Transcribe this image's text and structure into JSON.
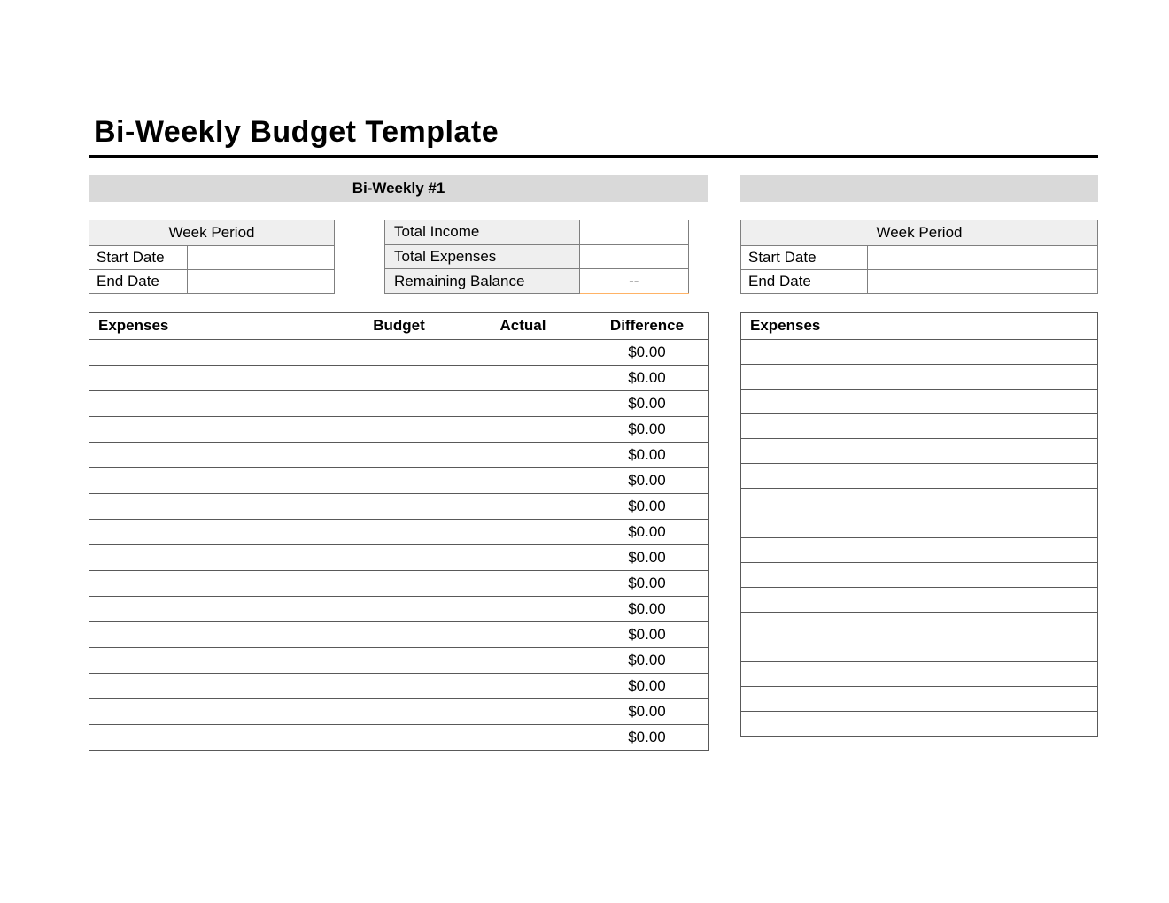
{
  "title": "Bi-Weekly Budget Template",
  "section1_header": "Bi-Weekly #1",
  "week_period": {
    "heading": "Week Period",
    "start_label": "Start Date",
    "end_label": "End Date",
    "start_value": "",
    "end_value": ""
  },
  "summary": {
    "total_income_label": "Total Income",
    "total_expenses_label": "Total Expenses",
    "remaining_balance_label": "Remaining Balance",
    "total_income_value": "",
    "total_expenses_value": "",
    "remaining_balance_value": "--"
  },
  "columns": {
    "expenses": "Expenses",
    "budget": "Budget",
    "actual": "Actual",
    "difference": "Difference"
  },
  "expense_rows": [
    {
      "name": "",
      "budget": "",
      "actual": "",
      "difference": "$0.00"
    },
    {
      "name": "",
      "budget": "",
      "actual": "",
      "difference": "$0.00"
    },
    {
      "name": "",
      "budget": "",
      "actual": "",
      "difference": "$0.00"
    },
    {
      "name": "",
      "budget": "",
      "actual": "",
      "difference": "$0.00"
    },
    {
      "name": "",
      "budget": "",
      "actual": "",
      "difference": "$0.00"
    },
    {
      "name": "",
      "budget": "",
      "actual": "",
      "difference": "$0.00"
    },
    {
      "name": "",
      "budget": "",
      "actual": "",
      "difference": "$0.00"
    },
    {
      "name": "",
      "budget": "",
      "actual": "",
      "difference": "$0.00"
    },
    {
      "name": "",
      "budget": "",
      "actual": "",
      "difference": "$0.00"
    },
    {
      "name": "",
      "budget": "",
      "actual": "",
      "difference": "$0.00"
    },
    {
      "name": "",
      "budget": "",
      "actual": "",
      "difference": "$0.00"
    },
    {
      "name": "",
      "budget": "",
      "actual": "",
      "difference": "$0.00"
    },
    {
      "name": "",
      "budget": "",
      "actual": "",
      "difference": "$0.00"
    },
    {
      "name": "",
      "budget": "",
      "actual": "",
      "difference": "$0.00"
    },
    {
      "name": "",
      "budget": "",
      "actual": "",
      "difference": "$0.00"
    },
    {
      "name": "",
      "budget": "",
      "actual": "",
      "difference": "$0.00"
    }
  ],
  "section2": {
    "header": "",
    "week_period": {
      "heading": "Week Period",
      "start_label": "Start Date",
      "end_label": "End Date",
      "start_value": "",
      "end_value": ""
    },
    "columns": {
      "expenses": "Expenses"
    },
    "rows": [
      "",
      "",
      "",
      "",
      "",
      "",
      "",
      "",
      "",
      "",
      "",
      "",
      "",
      "",
      "",
      ""
    ]
  }
}
